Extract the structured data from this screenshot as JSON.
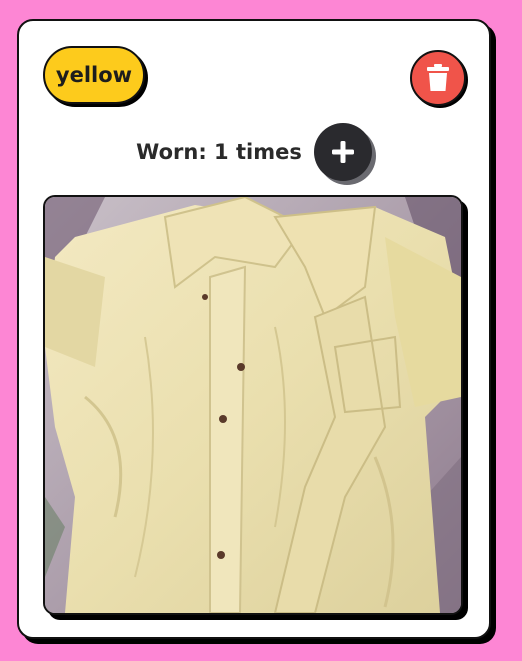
{
  "item": {
    "color_label": "yellow",
    "worn_text": "Worn: 1 times",
    "delete_icon": "trash-icon",
    "add_icon": "plus-icon",
    "photo_subject": "yellow button-up shirt photo"
  },
  "colors": {
    "page_background": "#fd86d4",
    "color_tag": "#fdcb1c",
    "delete_button": "#f0544a",
    "add_button": "#2a2a2e"
  }
}
